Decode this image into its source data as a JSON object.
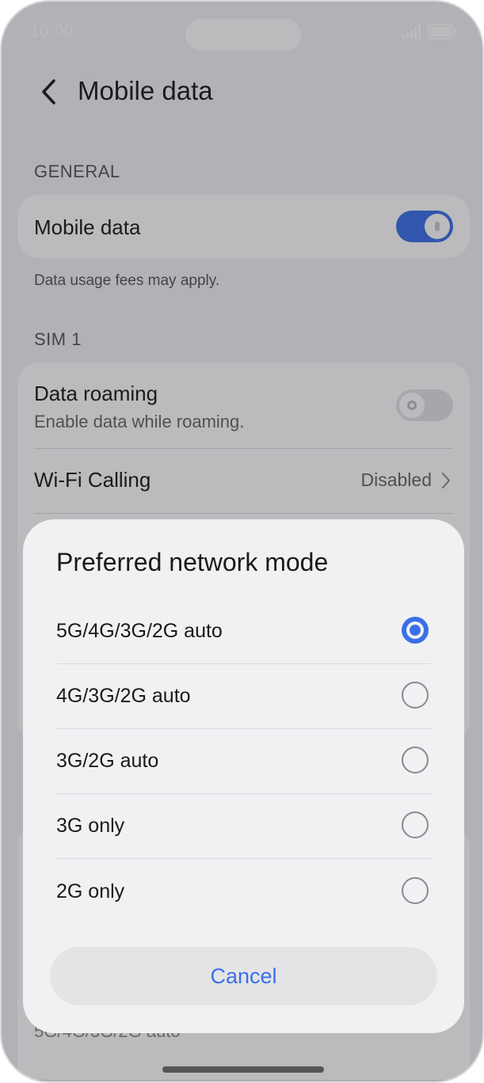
{
  "status_bar": {
    "time": "10:00"
  },
  "header": {
    "title": "Mobile data"
  },
  "general": {
    "section_label": "GENERAL",
    "mobile_data": {
      "label": "Mobile data",
      "enabled": true
    },
    "hint": "Data usage fees may apply."
  },
  "sim1": {
    "section_label": "SIM 1",
    "data_roaming": {
      "label": "Data roaming",
      "sublabel": "Enable data while roaming.",
      "enabled": false
    },
    "wifi_calling": {
      "label": "Wi-Fi Calling",
      "value": "Disabled"
    }
  },
  "background_bottom": {
    "partial_text": "5G/4G/3G/2G auto"
  },
  "dialog": {
    "title": "Preferred network mode",
    "options": [
      {
        "label": "5G/4G/3G/2G auto",
        "selected": true
      },
      {
        "label": "4G/3G/2G auto",
        "selected": false
      },
      {
        "label": "3G/2G auto",
        "selected": false
      },
      {
        "label": "3G only",
        "selected": false
      },
      {
        "label": "2G only",
        "selected": false
      }
    ],
    "cancel_label": "Cancel"
  },
  "colors": {
    "accent": "#3b6fe8",
    "toggle_off": "#e3e3e6",
    "dialog_bg": "#f1f1f3"
  }
}
